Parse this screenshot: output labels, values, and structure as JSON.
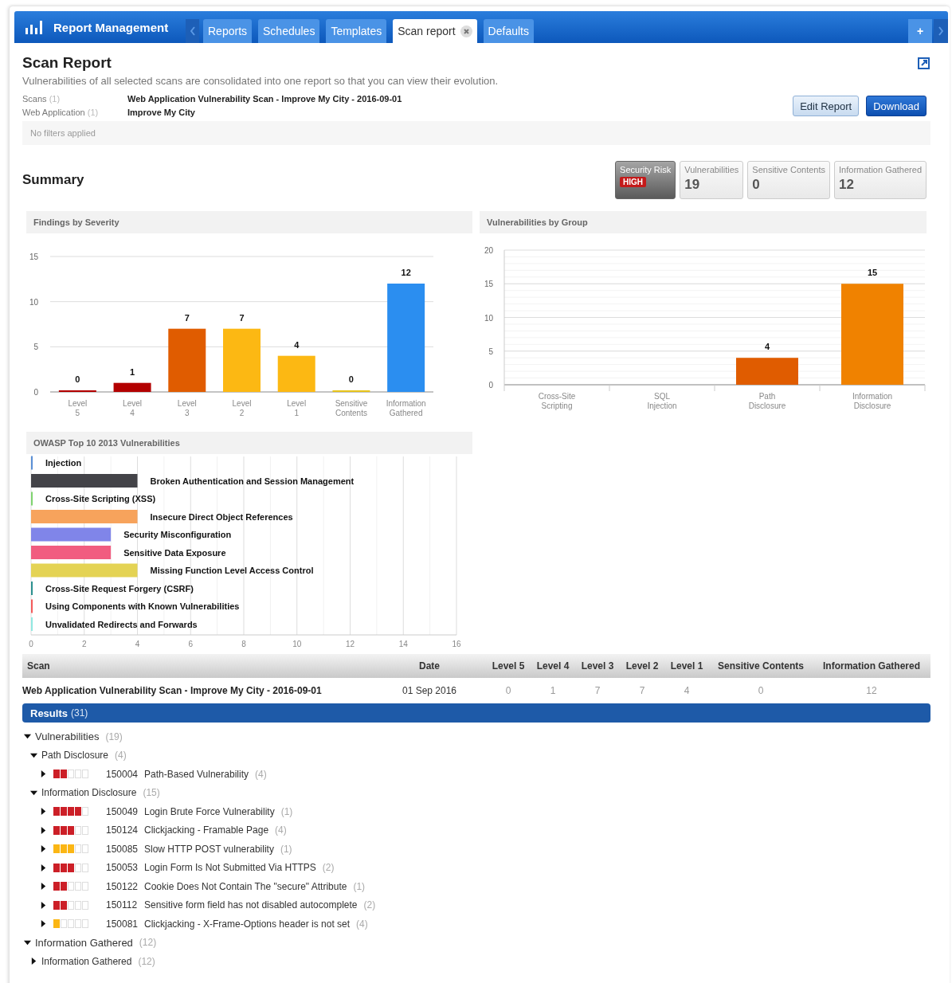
{
  "header": {
    "title": "Report Management",
    "add_label": "+"
  },
  "tabs": [
    {
      "label": "Reports",
      "selected": false,
      "closable": false
    },
    {
      "label": "Schedules",
      "selected": false,
      "closable": false
    },
    {
      "label": "Templates",
      "selected": false,
      "closable": false
    },
    {
      "label": "Scan report",
      "selected": true,
      "closable": true
    },
    {
      "label": "Defaults",
      "selected": false,
      "closable": false
    }
  ],
  "report": {
    "title": "Scan Report",
    "description": "Vulnerabilities of all selected scans are consolidated into one report so that you can view their evolution.",
    "meta": [
      {
        "label": "Scans",
        "count": "(1)",
        "value": "Web Application Vulnerability Scan - Improve My City - 2016-09-01"
      },
      {
        "label": "Web Application",
        "count": "(1)",
        "value": "Improve My City"
      }
    ],
    "filters_note": "No filters applied",
    "buttons": [
      {
        "label": "Edit Report",
        "kind": "secondary"
      },
      {
        "label": "Download",
        "kind": "primary"
      }
    ]
  },
  "summary": {
    "title": "Summary",
    "cards": [
      {
        "kind": "risk",
        "label": "Security Risk",
        "badge": "HIGH"
      },
      {
        "kind": "count",
        "label": "Vulnerabilities",
        "value": "19"
      },
      {
        "kind": "count",
        "label": "Sensitive Contents",
        "value": "0"
      },
      {
        "kind": "count",
        "label": "Information Gathered",
        "value": "12"
      }
    ]
  },
  "charts": [
    {
      "title": "Findings by Severity",
      "chart_data": {
        "type": "bar",
        "categories": [
          "Level 5",
          "Level 4",
          "Level 3",
          "Level 2",
          "Level 1",
          "Sensitive Contents",
          "Information Gathered"
        ],
        "values": [
          0,
          1,
          7,
          7,
          4,
          0,
          12
        ],
        "colors": [
          "#b30000",
          "#b30000",
          "#e05c00",
          "#fcb813",
          "#fcb813",
          "#e8c51a",
          "#2b8ef0"
        ],
        "ylim": [
          0,
          15
        ],
        "yticks": [
          0,
          5,
          10,
          15
        ],
        "data_labels": true,
        "grid": true
      }
    },
    {
      "title": "Vulnerabilities by Group",
      "chart_data": {
        "type": "bar",
        "categories": [
          "Cross-Site Scripting",
          "SQL Injection",
          "Path Disclosure",
          "Information Disclosure"
        ],
        "values": [
          0,
          0,
          4,
          15
        ],
        "colors": [
          "#e05c00",
          "#e05c00",
          "#e05c00",
          "#f08200"
        ],
        "ylim": [
          0,
          20
        ],
        "yticks": [
          0,
          5,
          10,
          15,
          20
        ],
        "value_labels": [
          null,
          null,
          "4",
          "15"
        ],
        "grid": true
      }
    },
    {
      "title": "OWASP Top 10 2013 Vulnerabilities",
      "chart_data": {
        "type": "bar",
        "orientation": "horizontal",
        "categories": [
          "Injection",
          "Broken Authentication and Session Management",
          "Cross-Site Scripting (XSS)",
          "Insecure Direct Object References",
          "Security Misconfiguration",
          "Sensitive Data Exposure",
          "Missing Function Level Access Control",
          "Cross-Site Request Forgery (CSRF)",
          "Using Components with Known Vulnerabilities",
          "Unvalidated Redirects and Forwards"
        ],
        "values": [
          0,
          4,
          0,
          4,
          3,
          3,
          4,
          0,
          0,
          0
        ],
        "colors": [
          "#5a8fd6",
          "#434348",
          "#7fd36f",
          "#f7a35c",
          "#8085e9",
          "#f15c80",
          "#e4d354",
          "#2b908f",
          "#f45b5b",
          "#91e8e1"
        ],
        "xlim": [
          0,
          16
        ],
        "xticks": [
          0,
          2,
          4,
          6,
          8,
          10,
          12,
          14,
          16
        ],
        "grid": true
      }
    }
  ],
  "scan_table": {
    "columns": [
      "Scan",
      "Date",
      "Level 5",
      "Level 4",
      "Level 3",
      "Level 2",
      "Level 1",
      "Sensitive Contents",
      "Information Gathered"
    ],
    "rows": [
      [
        "Web Application Vulnerability Scan - Improve My City - 2016-09-01",
        "01 Sep 2016",
        "0",
        "1",
        "7",
        "7",
        "4",
        "0",
        "12"
      ]
    ]
  },
  "results": {
    "title": "Results",
    "count": "(31)",
    "tree": [
      {
        "kind": "group",
        "label": "Vulnerabilities",
        "count": "(19)",
        "expanded": true,
        "children": [
          {
            "kind": "group",
            "label": "Path Disclosure",
            "count": "(4)",
            "expanded": true,
            "children": [
              {
                "kind": "finding",
                "id": "150004",
                "label": "Path-Based Vulnerability",
                "count": "(4)",
                "expanded": false,
                "stars": 2,
                "color": "#cc1f27"
              }
            ]
          },
          {
            "kind": "group",
            "label": "Information Disclosure",
            "count": "(15)",
            "expanded": true,
            "children": [
              {
                "kind": "finding",
                "id": "150049",
                "label": "Login Brute Force Vulnerability",
                "count": "(1)",
                "expanded": false,
                "stars": 4,
                "color": "#cc1f27"
              },
              {
                "kind": "finding",
                "id": "150124",
                "label": "Clickjacking - Framable Page",
                "count": "(4)",
                "expanded": false,
                "stars": 3,
                "color": "#cc1f27"
              },
              {
                "kind": "finding",
                "id": "150085",
                "label": "Slow HTTP POST vulnerability",
                "count": "(1)",
                "expanded": false,
                "stars": 3,
                "color": "#fbb614"
              },
              {
                "kind": "finding",
                "id": "150053",
                "label": "Login Form Is Not Submitted Via HTTPS",
                "count": "(2)",
                "expanded": false,
                "stars": 3,
                "color": "#cc1f27"
              },
              {
                "kind": "finding",
                "id": "150122",
                "label": "Cookie Does Not Contain The \"secure\" Attribute",
                "count": "(1)",
                "expanded": false,
                "stars": 2,
                "color": "#cc1f27"
              },
              {
                "kind": "finding",
                "id": "150112",
                "label": "Sensitive form field has not disabled autocomplete",
                "count": "(2)",
                "expanded": false,
                "stars": 2,
                "color": "#cc1f27"
              },
              {
                "kind": "finding",
                "id": "150081",
                "label": "Clickjacking - X-Frame-Options header is not set",
                "count": "(4)",
                "expanded": false,
                "stars": 1,
                "color": "#fbb614"
              }
            ]
          }
        ]
      },
      {
        "kind": "group",
        "label": "Information Gathered",
        "count": "(12)",
        "expanded": true,
        "children": [
          {
            "kind": "group",
            "label": "Information Gathered",
            "count": "(12)",
            "expanded": false
          }
        ]
      }
    ]
  }
}
